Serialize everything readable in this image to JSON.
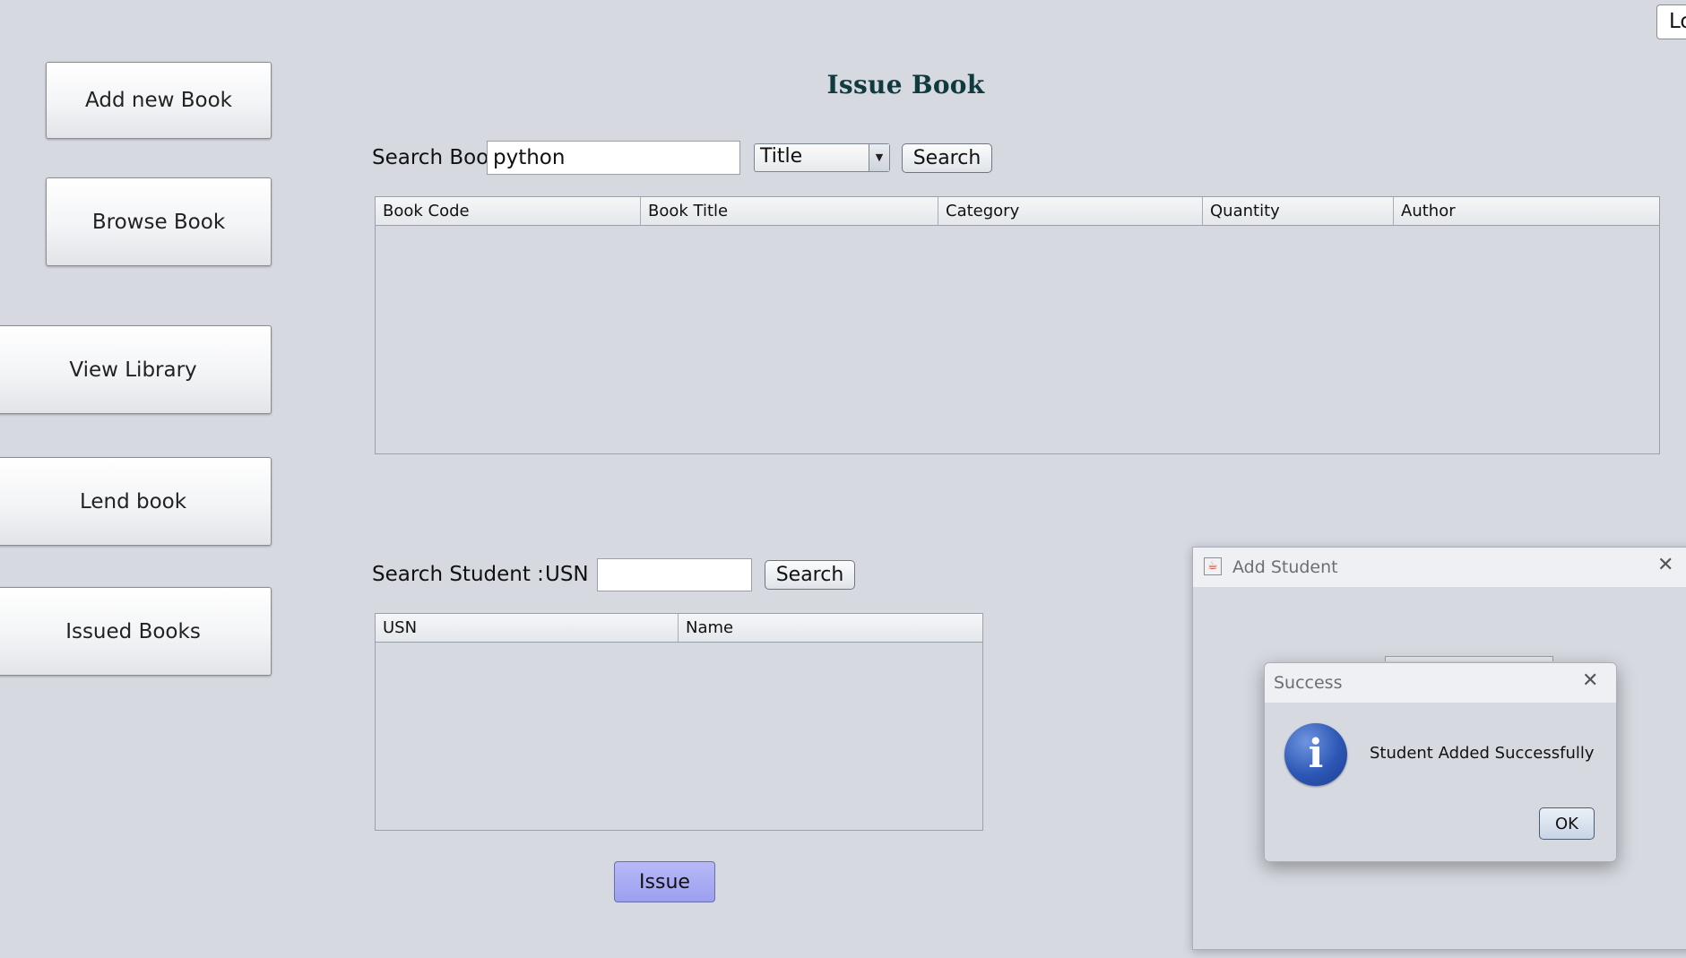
{
  "sidebar": {
    "add_new_book": "Add new Book",
    "browse_book": "Browse Book",
    "view_library": "View Library",
    "lend_book": "Lend book",
    "issued_books": "Issued Books"
  },
  "header": {
    "logout_partial": "Lo",
    "title": "Issue Book"
  },
  "book_search": {
    "label": "Search Book",
    "value": "python",
    "filter_selected": "Title",
    "search_label": "Search",
    "columns": [
      "Book Code",
      "Book Title",
      "Category",
      "Quantity",
      "Author"
    ],
    "rows": []
  },
  "student_search": {
    "label": "Search Student :",
    "usn_label": "USN",
    "value": "",
    "search_label": "Search",
    "columns": [
      "USN",
      "Name"
    ],
    "rows": []
  },
  "issue_button": "Issue",
  "add_student_dialog": {
    "title": "Add Student",
    "close_icon": "close-icon",
    "app_icon": "java-icon"
  },
  "success_dialog": {
    "title": "Success",
    "message": "Student Added Successfully",
    "ok_label": "OK",
    "icon": "info-icon",
    "icon_color": "#2d57b5"
  }
}
